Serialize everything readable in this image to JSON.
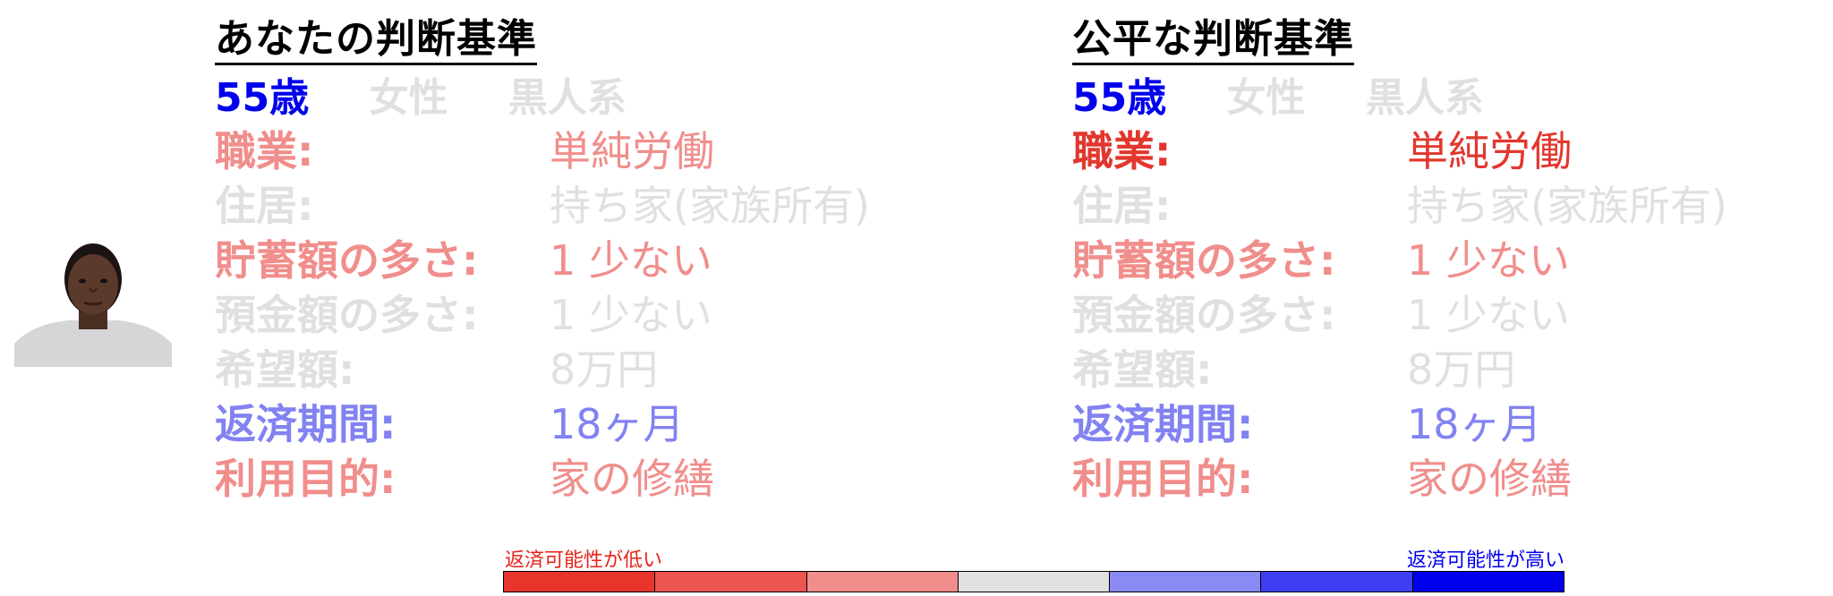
{
  "left_panel": {
    "title": "あなたの判断基準",
    "demographics": {
      "age": "55歳",
      "gender": "女性",
      "ethnicity": "黒人系"
    },
    "rows": [
      {
        "label": "職業:",
        "value": "単純労働"
      },
      {
        "label": "住居:",
        "value": "持ち家(家族所有)"
      },
      {
        "label": "貯蓄額の多さ:",
        "value": "1 少ない"
      },
      {
        "label": "預金額の多さ:",
        "value": "1 少ない"
      },
      {
        "label": "希望額:",
        "value": "8万円"
      },
      {
        "label": "返済期間:",
        "value": "18ヶ月"
      },
      {
        "label": "利用目的:",
        "value": "家の修繕"
      }
    ]
  },
  "right_panel": {
    "title": "公平な判断基準",
    "demographics": {
      "age": "55歳",
      "gender": "女性",
      "ethnicity": "黒人系"
    },
    "rows": [
      {
        "label": "職業:",
        "value": "単純労働"
      },
      {
        "label": "住居:",
        "value": "持ち家(家族所有)"
      },
      {
        "label": "貯蓄額の多さ:",
        "value": "1 少ない"
      },
      {
        "label": "預金額の多さ:",
        "value": "1 少ない"
      },
      {
        "label": "希望額:",
        "value": "8万円"
      },
      {
        "label": "返済期間:",
        "value": "18ヶ月"
      },
      {
        "label": "利用目的:",
        "value": "家の修繕"
      }
    ]
  },
  "legend": {
    "low_label": "返済可能性が低い",
    "high_label": "返済可能性が高い",
    "colors": [
      "#e8342a",
      "#ec5550",
      "#f08e8c",
      "#e0e0e0",
      "#8a8af4",
      "#3e3ef5",
      "#0000ee"
    ]
  },
  "colors": {
    "title": "#000000",
    "age": "#0000ee",
    "muted": "#e0e0e0",
    "light_red": "#f08e8c",
    "red": "#e2372e",
    "light_blue": "#8282f2"
  },
  "avatar": {
    "icon": "person-portrait-icon"
  }
}
